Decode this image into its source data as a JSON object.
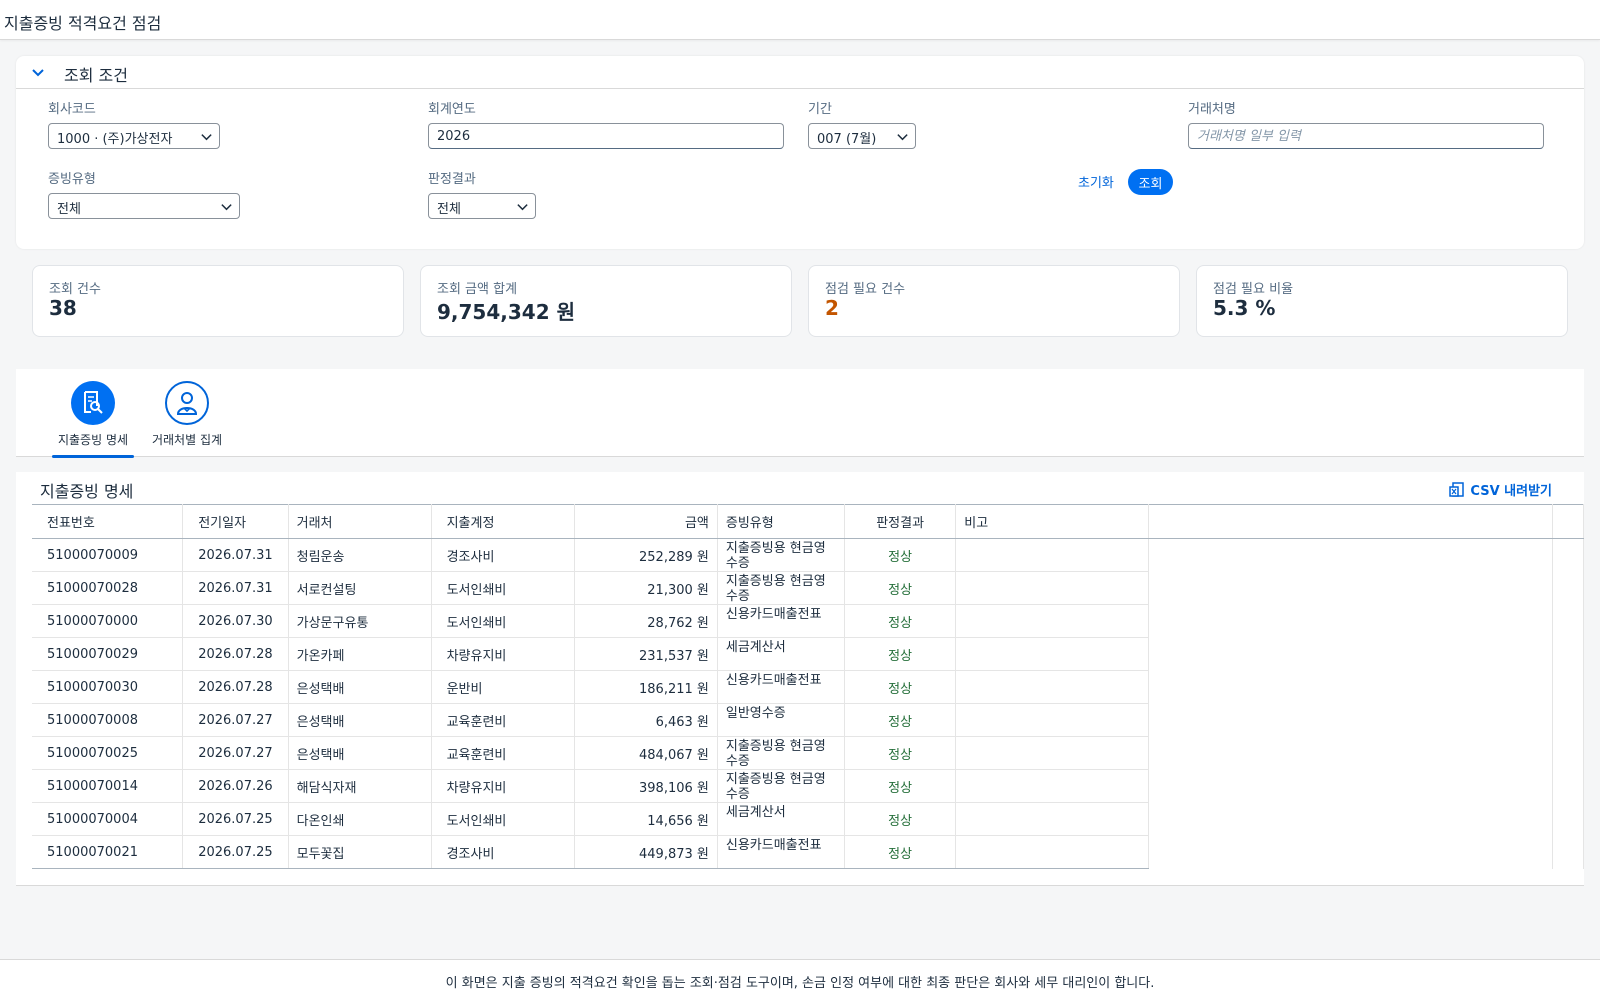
{
  "app": {
    "title": "지출증빙 적격요건 점검"
  },
  "filter": {
    "title": "조회 조건",
    "company_label": "회사코드",
    "company_value": "1000 · (주)가상전자",
    "year_label": "회계연도",
    "year_value": "2026",
    "period_label": "기간",
    "period_value": "007 (7월)",
    "vendor_label": "거래처명",
    "vendor_placeholder": "거래처명 일부 입력",
    "evidence_label": "증빙유형",
    "evidence_value": "전체",
    "result_label": "판정결과",
    "result_value": "전체",
    "reset_label": "초기화",
    "search_label": "조회"
  },
  "kpis": [
    {
      "label": "조회 건수",
      "value": "38"
    },
    {
      "label": "조회 금액 합계",
      "value": "9,754,342 원"
    },
    {
      "label": "점검 필요 건수",
      "value": "2"
    },
    {
      "label": "점검 필요 비율",
      "value": "5.3 %"
    }
  ],
  "tabs": [
    {
      "label": "지출증빙 명세"
    },
    {
      "label": "거래처별 집계"
    }
  ],
  "table": {
    "title": "지출증빙 명세",
    "csv_label": "CSV 내려받기",
    "columns": [
      "전표번호",
      "전기일자",
      "거래처",
      "지출계정",
      "금액",
      "증빙유형",
      "판정결과",
      "비고"
    ],
    "rows": [
      [
        "51000070009",
        "2026.07.31",
        "청림운송",
        "경조사비",
        "252,289 원",
        "지출증빙용 현금영수증",
        "정상",
        ""
      ],
      [
        "51000070028",
        "2026.07.31",
        "서로컨설팅",
        "도서인쇄비",
        "21,300 원",
        "지출증빙용 현금영수증",
        "정상",
        ""
      ],
      [
        "51000070000",
        "2026.07.30",
        "가상문구유통",
        "도서인쇄비",
        "28,762 원",
        "신용카드매출전표",
        "정상",
        ""
      ],
      [
        "51000070029",
        "2026.07.28",
        "가온카페",
        "차량유지비",
        "231,537 원",
        "세금계산서",
        "정상",
        ""
      ],
      [
        "51000070030",
        "2026.07.28",
        "은성택배",
        "운반비",
        "186,211 원",
        "신용카드매출전표",
        "정상",
        ""
      ],
      [
        "51000070008",
        "2026.07.27",
        "은성택배",
        "교육훈련비",
        "6,463 원",
        "일반영수증",
        "정상",
        ""
      ],
      [
        "51000070025",
        "2026.07.27",
        "은성택배",
        "교육훈련비",
        "484,067 원",
        "지출증빙용 현금영수증",
        "정상",
        ""
      ],
      [
        "51000070014",
        "2026.07.26",
        "해담식자재",
        "차량유지비",
        "398,106 원",
        "지출증빙용 현금영수증",
        "정상",
        ""
      ],
      [
        "51000070004",
        "2026.07.25",
        "다온인쇄",
        "도서인쇄비",
        "14,656 원",
        "세금계산서",
        "정상",
        ""
      ],
      [
        "51000070021",
        "2026.07.25",
        "모두꽃집",
        "경조사비",
        "449,873 원",
        "신용카드매출전표",
        "정상",
        ""
      ]
    ]
  },
  "footer": {
    "text": "이 화면은 지출 증빙의 적격요건 확인을 돕는 조회·점검 도구이며, 손금 인정 여부에 대한 최종 판단은 회사와 세무 대리인이 합니다."
  },
  "colors": {
    "accent": "#0070f2",
    "positive": "#256f3a",
    "warning": "#c35500"
  }
}
